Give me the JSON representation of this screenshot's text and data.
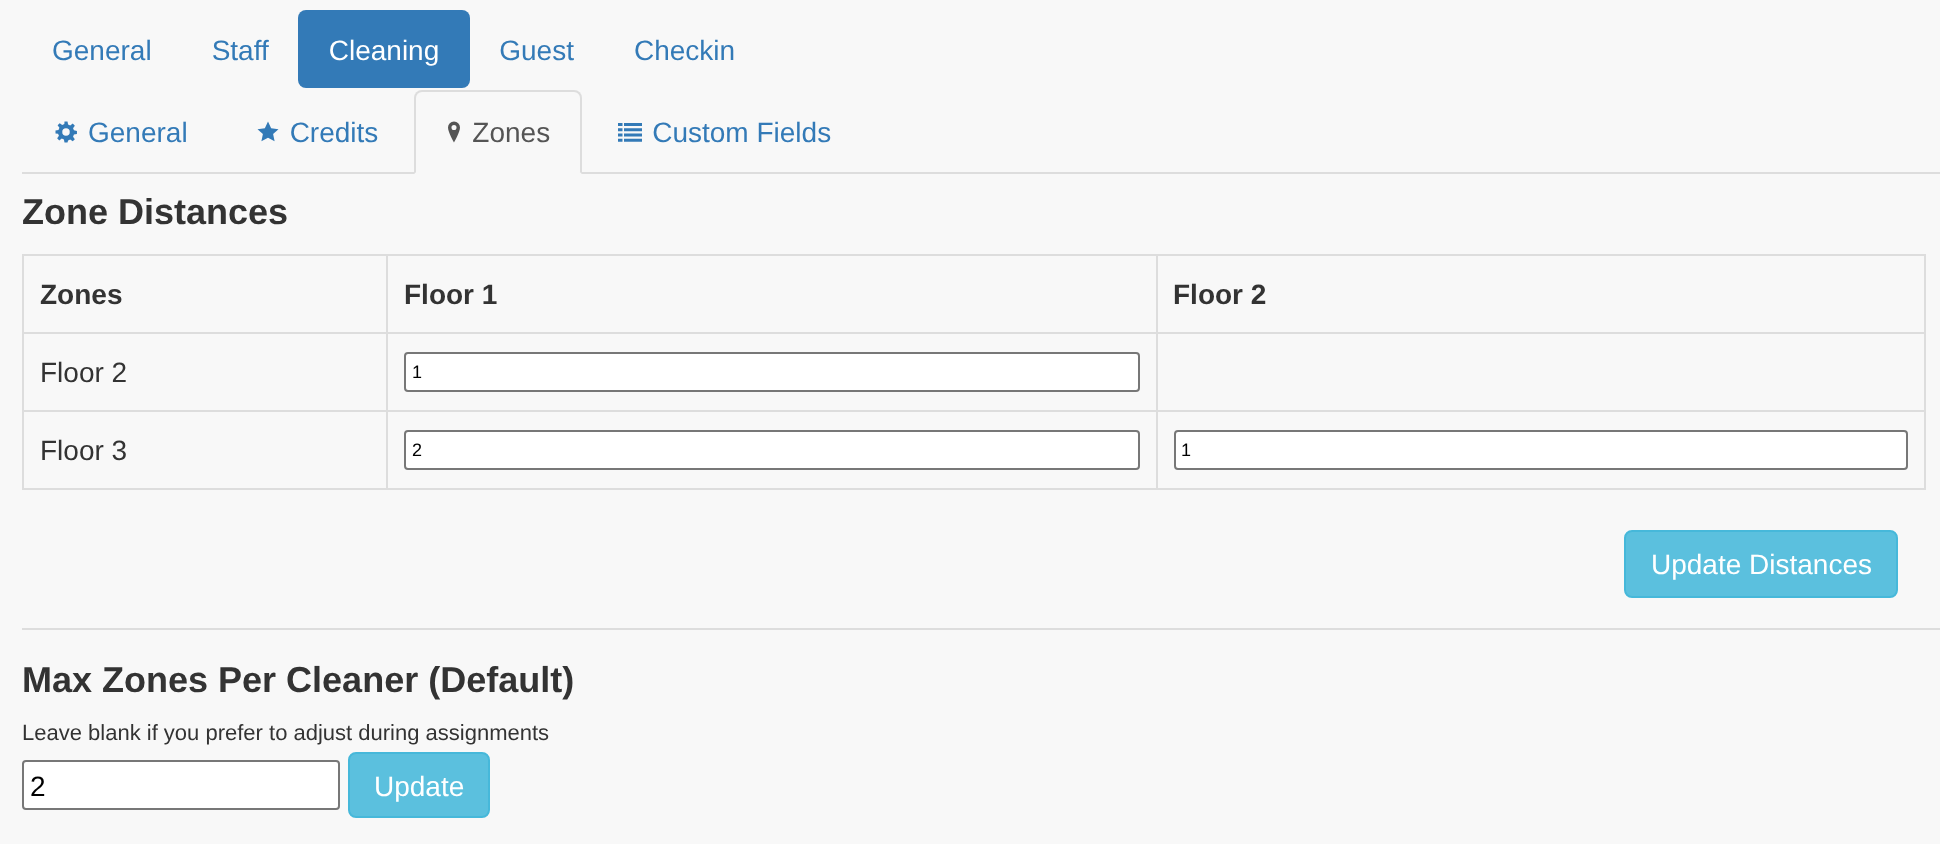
{
  "main_tabs": [
    {
      "label": "General",
      "selected": false
    },
    {
      "label": "Staff",
      "selected": false
    },
    {
      "label": "Cleaning",
      "selected": true
    },
    {
      "label": "Guest",
      "selected": false
    },
    {
      "label": "Checkin",
      "selected": false
    }
  ],
  "sub_tabs": [
    {
      "label": "General",
      "selected": false
    },
    {
      "label": "Credits",
      "selected": false
    },
    {
      "label": "Zones",
      "selected": true
    },
    {
      "label": "Custom Fields",
      "selected": false
    }
  ],
  "zone_distances": {
    "title": "Zone Distances",
    "columns": [
      "Zones",
      "Floor 1",
      "Floor 2"
    ],
    "rows": [
      {
        "cells": [
          {
            "kind": "label",
            "value": "Floor 2"
          },
          {
            "kind": "input",
            "value": "1"
          },
          {
            "kind": "empty"
          }
        ]
      },
      {
        "cells": [
          {
            "kind": "label",
            "value": "Floor 3"
          },
          {
            "kind": "input",
            "value": "2"
          },
          {
            "kind": "input",
            "value": "1"
          }
        ]
      }
    ],
    "button": "Update Distances"
  },
  "max_zones": {
    "title": "Max Zones Per Cleaner (Default)",
    "hint": "Leave blank if you prefer to adjust during assignments",
    "value": "2",
    "button": "Update"
  }
}
